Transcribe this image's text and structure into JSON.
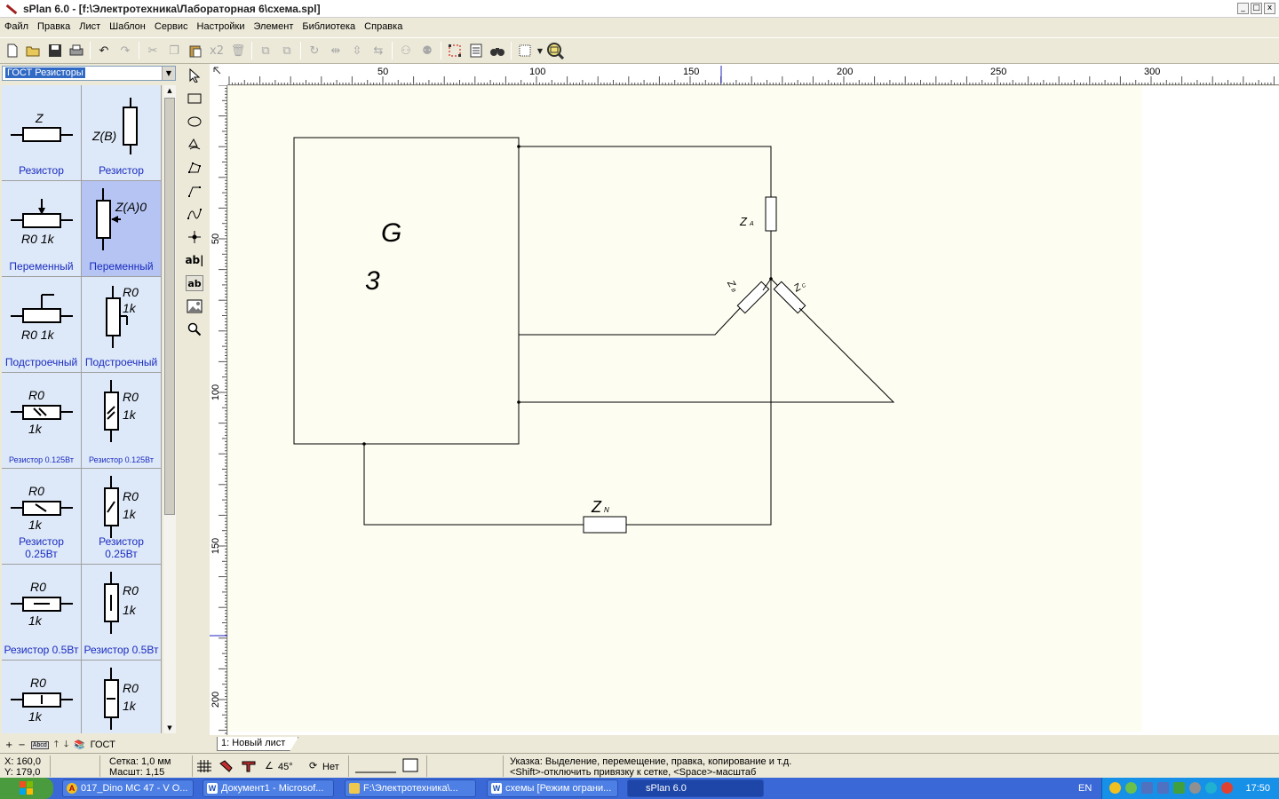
{
  "window": {
    "title": "sPlan 6.0 - [f:\\Электротехника\\Лабораторная 6\\схема.spl]",
    "min": "_",
    "max": "□",
    "close": "x"
  },
  "menu": [
    "Файл",
    "Правка",
    "Лист",
    "Шаблон",
    "Сервис",
    "Настройки",
    "Элемент",
    "Библиотека",
    "Справка"
  ],
  "toolbar": {
    "x2_label": "x2"
  },
  "library": {
    "selected": "ГОСТ Резисторы",
    "cells": [
      {
        "caption": "Резистор",
        "label": "Z"
      },
      {
        "caption": "Резистор",
        "label": "Z(B)"
      },
      {
        "caption": "Переменный",
        "label": "R0 1k"
      },
      {
        "caption": "Переменный",
        "label": "Z(A)0"
      },
      {
        "caption": "Подстроечный",
        "label": "R0  1k"
      },
      {
        "caption": "Подстроечный",
        "label1": "R0",
        "label2": "1k"
      },
      {
        "caption": "Резистор 0.125Вт",
        "label1": "R0",
        "label2": "1k"
      },
      {
        "caption": "Резистор 0.125Вт",
        "label1": "R0",
        "label2": "1k"
      },
      {
        "caption": "Резистор 0.25Вт",
        "label1": "R0",
        "label2": "1k"
      },
      {
        "caption": "Резистор 0.25Вт",
        "label1": "R0",
        "label2": "1k"
      },
      {
        "caption": "Резистор 0.5Вт",
        "label1": "R0",
        "label2": "1k"
      },
      {
        "caption": "Резистор 0.5Вт",
        "label1": "R0",
        "label2": "1k"
      },
      {
        "caption": "",
        "label1": "R0",
        "label2": "1k"
      },
      {
        "caption": "",
        "label1": "R0",
        "label2": "1k"
      }
    ],
    "footer_label": "ГОСТ",
    "abcd": "Abcd"
  },
  "drawtools": {
    "text1": "ab|",
    "text2": "ab"
  },
  "ruler": {
    "h_ticks": [
      "50",
      "100",
      "150",
      "200",
      "250",
      "300"
    ],
    "v_ticks": [
      "50",
      "100",
      "150",
      "200"
    ]
  },
  "schematic": {
    "generator": "G",
    "phase": "3",
    "za": "Z",
    "za_sub": "A",
    "zb": "Z",
    "zb_sub": "B",
    "zc": "Z",
    "zc_sub": "C",
    "zn": "Z",
    "zn_sub": "N"
  },
  "tab": "1: Новый лист",
  "status": {
    "x": "X: 160,0",
    "y": "Y: 179,0",
    "grid": "Сетка:  1,0 мм",
    "zoom": "Масшт:  1,15",
    "angle": "45°",
    "snap": "Нет",
    "hint1": "Указка: Выделение, перемещение, правка, копирование и т.д.",
    "hint2": "<Shift>-отключить привязку к сетке, <Space>-масштаб"
  },
  "taskbar": {
    "tasks": [
      {
        "label": "017_Dino MC 47 - V O...",
        "icon": "А"
      },
      {
        "label": "Документ1 - Microsof...",
        "icon": "W"
      },
      {
        "label": "F:\\Электротехника\\...",
        "icon": ""
      },
      {
        "label": "схемы [Режим ограни...",
        "icon": "W"
      },
      {
        "label": "sPlan 6.0",
        "icon": ""
      }
    ],
    "lang": "EN",
    "clock": "17:50"
  }
}
